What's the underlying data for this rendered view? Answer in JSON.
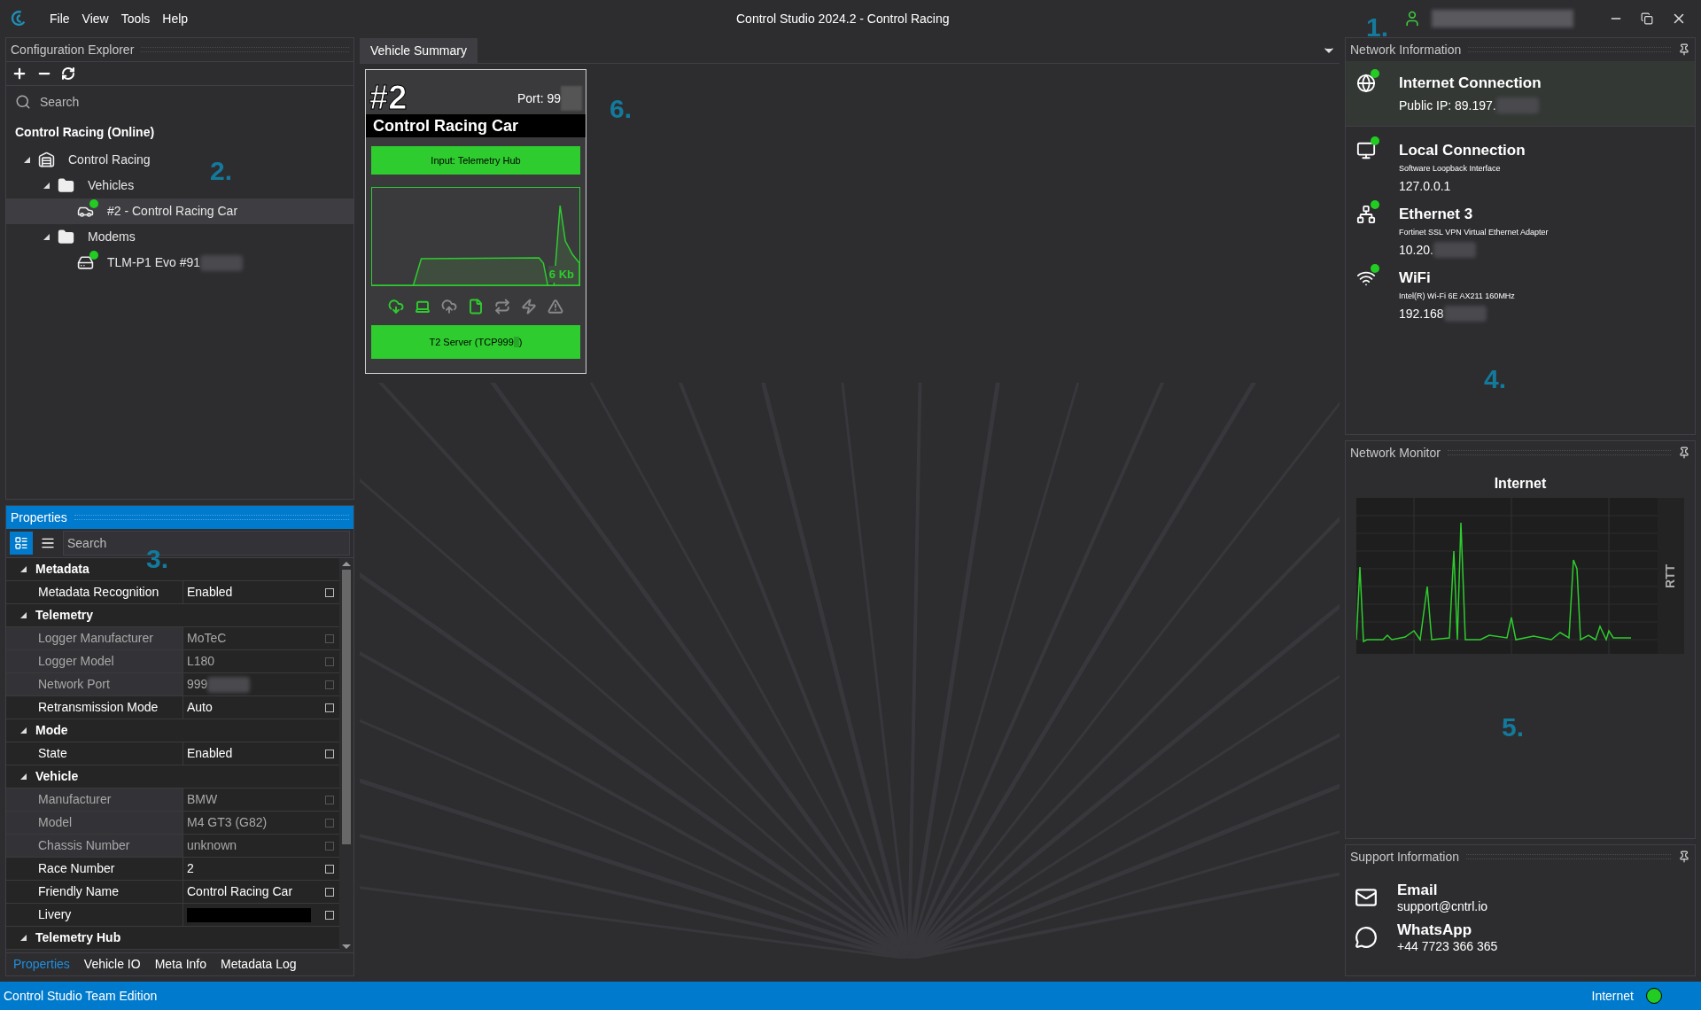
{
  "window": {
    "title": "Control Studio 2024.2 - Control Racing",
    "menu": [
      "File",
      "View",
      "Tools",
      "Help"
    ]
  },
  "explorer": {
    "title": "Configuration Explorer",
    "search": {
      "placeholder": "Search"
    },
    "root": "Control Racing (Online)",
    "tree": [
      {
        "label": "Control Racing",
        "kind": "building",
        "expanded": true,
        "children": [
          {
            "label": "Vehicles",
            "kind": "folder",
            "expanded": true,
            "children": [
              {
                "label": "#2 - Control Racing Car",
                "kind": "car",
                "online": true,
                "selected": true,
                "redacted": false
              }
            ]
          },
          {
            "label": "Modems",
            "kind": "folder",
            "expanded": true,
            "children": [
              {
                "label": "TLM-P1 Evo #91",
                "kind": "modem",
                "online": true,
                "selected": false,
                "redacted": true
              }
            ]
          }
        ]
      }
    ]
  },
  "properties": {
    "title": "Properties",
    "search": {
      "placeholder": "Search"
    },
    "view_modes": [
      {
        "kind": "categorized",
        "selected": true
      },
      {
        "kind": "list",
        "selected": false
      }
    ],
    "rows": [
      {
        "kind": "group",
        "label": "Metadata",
        "expanded": true
      },
      {
        "kind": "property",
        "label": "Metadata Recognition",
        "value": "Enabled",
        "readonly": false
      },
      {
        "kind": "group",
        "label": "Telemetry",
        "expanded": true
      },
      {
        "kind": "property",
        "label": "Logger Manufacturer",
        "value": "MoTeC",
        "readonly": true
      },
      {
        "kind": "property",
        "label": "Logger Model",
        "value": "L180",
        "readonly": true
      },
      {
        "kind": "property",
        "label": "Network Port",
        "value": "999",
        "readonly": true,
        "redacted": true
      },
      {
        "kind": "property",
        "label": "Retransmission Mode",
        "value": "Auto",
        "readonly": false
      },
      {
        "kind": "group",
        "label": "Mode",
        "expanded": true
      },
      {
        "kind": "property",
        "label": "State",
        "value": "Enabled",
        "readonly": false
      },
      {
        "kind": "group",
        "label": "Vehicle",
        "expanded": true
      },
      {
        "kind": "property",
        "label": "Manufacturer",
        "value": "BMW",
        "readonly": true
      },
      {
        "kind": "property",
        "label": "Model",
        "value": "M4 GT3 (G82)",
        "readonly": true
      },
      {
        "kind": "property",
        "label": "Chassis Number",
        "value": "unknown",
        "readonly": true
      },
      {
        "kind": "property",
        "label": "Race Number",
        "value": "2",
        "readonly": false
      },
      {
        "kind": "property",
        "label": "Friendly Name",
        "value": "Control Racing Car",
        "readonly": false
      },
      {
        "kind": "swatch",
        "label": "Livery",
        "color": "#000000",
        "readonly": false
      },
      {
        "kind": "group",
        "label": "Telemetry Hub",
        "expanded": true
      }
    ],
    "tabs": [
      {
        "label": "Properties",
        "selected": true
      },
      {
        "label": "Vehicle IO",
        "selected": false
      },
      {
        "label": "Meta Info",
        "selected": false
      },
      {
        "label": "Metadata Log",
        "selected": false
      }
    ]
  },
  "document": {
    "tabs": [
      {
        "label": "Vehicle Summary",
        "selected": true
      }
    ],
    "card": {
      "number": "#2",
      "port": "Port: 99",
      "name": "Control Racing Car",
      "input": "Input: Telemetry Hub",
      "throughput": "6 Kb",
      "indicators": [
        {
          "kind": "download",
          "active": true
        },
        {
          "kind": "laptop",
          "active": true
        },
        {
          "kind": "upload",
          "active": false
        },
        {
          "kind": "file",
          "active": true
        },
        {
          "kind": "repeat",
          "active": false
        },
        {
          "kind": "power",
          "active": false
        },
        {
          "kind": "warning",
          "active": false
        }
      ],
      "output": "T2 Server (TCP999",
      "output_end": ")"
    }
  },
  "network_information": {
    "title": "Network Information",
    "items": [
      {
        "kind": "globe",
        "name": "Internet Connection",
        "address": "Public IP: 89.197.",
        "online": true,
        "selected": true
      },
      {
        "kind": "monitor",
        "name": "Local Connection",
        "adapter": "Software Loopback Interface",
        "address": "127.0.0.1",
        "online": true,
        "selected": false,
        "redacted": false
      },
      {
        "kind": "ethernet",
        "name": "Ethernet 3",
        "adapter": "Fortinet SSL VPN Virtual Ethernet Adapter",
        "address": "10.20.",
        "online": true,
        "selected": false,
        "redacted": true
      },
      {
        "kind": "wifi",
        "name": "WiFi",
        "adapter": "Intel(R) Wi-Fi 6E AX211 160MHz",
        "address": "192.168",
        "online": true,
        "selected": false,
        "redacted": true
      }
    ]
  },
  "network_monitor": {
    "title": "Network Monitor",
    "chart_title": "Internet",
    "axis_label": "RTT"
  },
  "support_information": {
    "title": "Support Information",
    "items": [
      {
        "kind": "email",
        "name": "Email",
        "value": "support@cntrl.io"
      },
      {
        "kind": "whatsapp",
        "name": "WhatsApp",
        "value": "+44 7723 366 365"
      }
    ]
  },
  "status_bar": {
    "edition": "Control Studio Team Edition",
    "connection": "Internet",
    "online": true
  },
  "callouts": [
    "1.",
    "2.",
    "3.",
    "4.",
    "5.",
    "6."
  ]
}
